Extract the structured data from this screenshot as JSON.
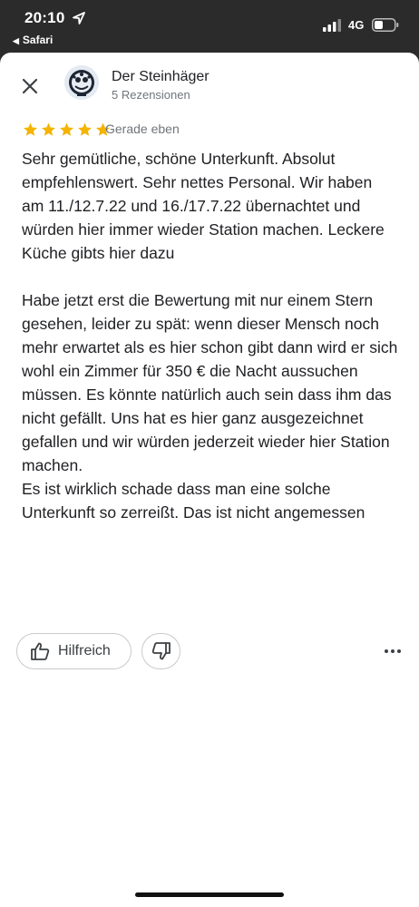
{
  "status_bar": {
    "time": "20:10",
    "back_app": "Safari",
    "network": "4G"
  },
  "review": {
    "author_name": "Der Steinhäger",
    "author_sub": "5 Rezensionen",
    "rating": 5,
    "rating_max": 5,
    "star_color": "#f4b400",
    "time_ago": "Gerade eben",
    "paragraph_1": "Sehr gemütliche, schöne Unterkunft. Absolut empfehlenswert. Sehr nettes Personal. Wir haben am 11./12.7.22 und 16./17.7.22 übernachtet und würden hier immer wieder Station machen. Leckere Küche gibts hier dazu",
    "paragraph_2": "Habe jetzt erst die Bewertung mit nur einem Stern gesehen, leider zu spät: wenn dieser Mensch noch mehr erwartet als es hier schon gibt dann wird er sich wohl ein Zimmer für 350 € die Nacht aussuchen müssen. Es könnte natürlich auch sein dass ihm das nicht gefällt. Uns hat es hier ganz ausgezeichnet gefallen und wir würden jederzeit wieder hier Station machen.\nEs ist wirklich schade dass man eine solche Unterkunft so zerreißt. Das ist nicht angemessen"
  },
  "actions": {
    "helpful_label": "Hilfreich"
  },
  "icons": {
    "close": "close-icon",
    "thumb_up": "thumbs-up-icon",
    "thumb_down": "thumbs-down-icon",
    "more": "more-horizontal-icon"
  }
}
